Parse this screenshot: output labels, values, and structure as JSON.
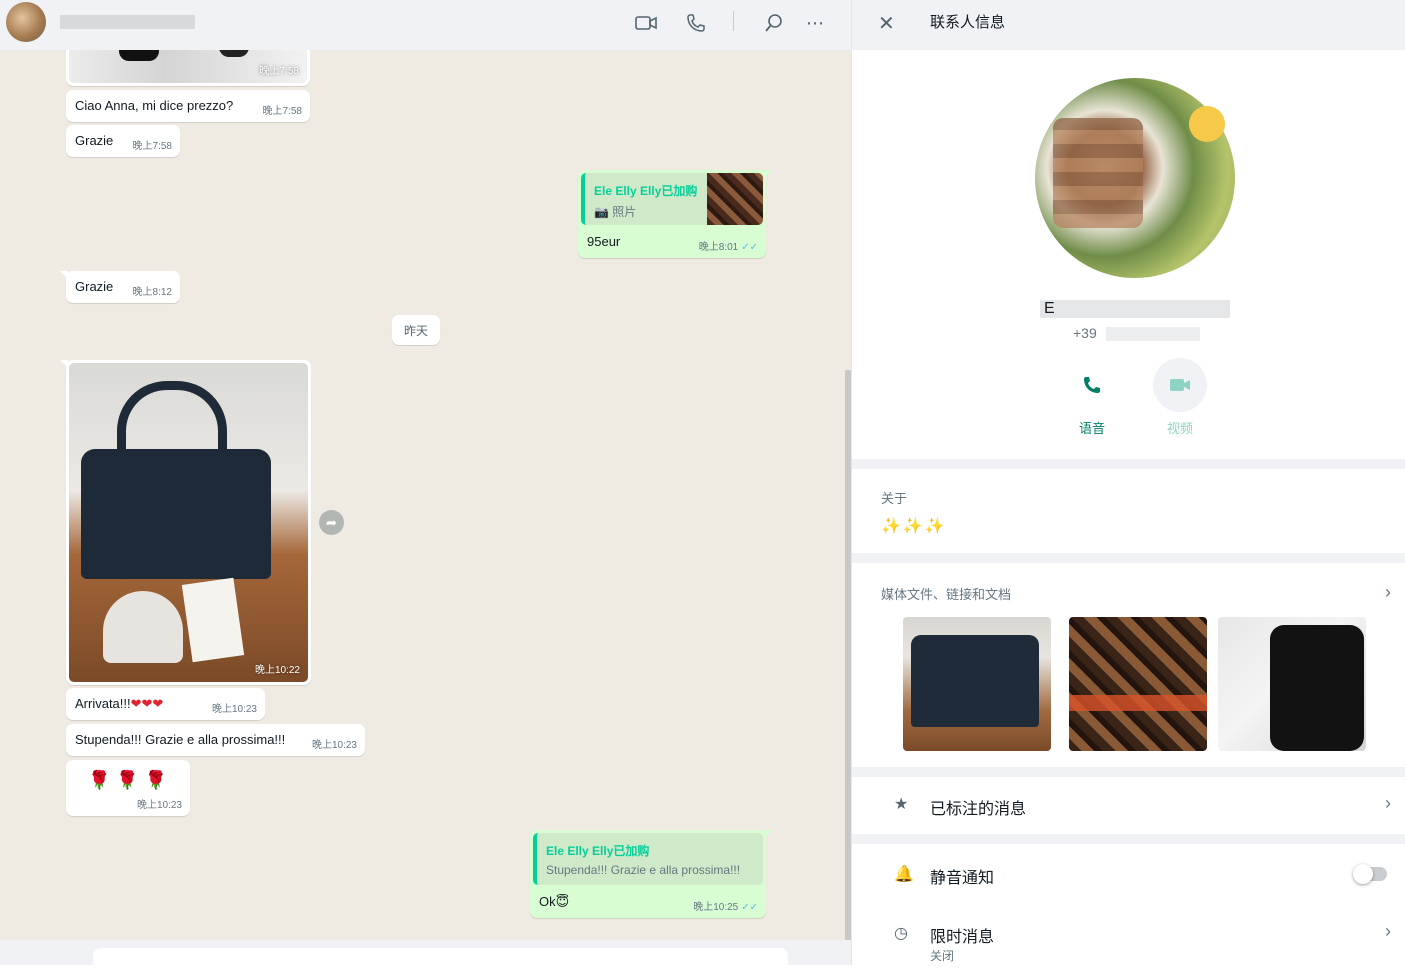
{
  "chat": {
    "messages": [
      {
        "text": "Ciao Anna, mi dice prezzo?",
        "time": "晚上7:58"
      },
      {
        "text": "Grazie",
        "time": "晚上7:58"
      },
      {
        "quote_name": "Ele Elly Elly已加购",
        "quote_text": "照片",
        "text": "95eur",
        "time": "晚上8:01"
      },
      {
        "text": "Grazie",
        "time": "晚上8:12"
      },
      {
        "photo_time": "晚上10:22"
      },
      {
        "text": "Arrivata!!!",
        "time": "晚上10:23"
      },
      {
        "text": "Stupenda!!! Grazie e alla prossima!!!",
        "time": "晚上10:23"
      },
      {
        "time": "晚上10:23"
      },
      {
        "quote_name": "Ele Elly Elly已加购",
        "quote_text": "Stupenda!!! Grazie e alla prossima!!!",
        "text": "Ok",
        "time": "晚上10:25"
      }
    ],
    "top_photo_time": "晚上7:58",
    "date_chip": "昨天"
  },
  "panel": {
    "title": "联系人信息",
    "name_visible": "E",
    "phone_visible": "+39",
    "actions": [
      {
        "label": "语音",
        "color": "#008069"
      },
      {
        "label": "视频",
        "color": "#8fd3c4"
      }
    ],
    "about_label": "关于",
    "about_value": "✨✨✨",
    "media_label": "媒体文件、链接和文档",
    "starred": "已标注的消息",
    "mute": "静音通知",
    "disappearing": "限时消息",
    "disappearing_value": "关闭"
  },
  "colors": {
    "accent": "#008069",
    "out_bubble": "#d9fdd3",
    "quote_name": "#06cf9c"
  }
}
